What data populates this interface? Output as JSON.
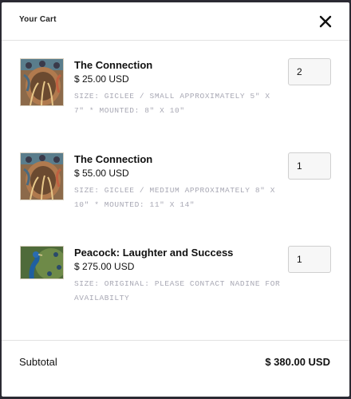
{
  "cart": {
    "title": "Your Cart",
    "close_icon": "close-icon"
  },
  "items": [
    {
      "name": "The Connection",
      "price": "$ 25.00 USD",
      "variant": "Size: Giclee / Small approximately 5\" x 7\" * Mounted: 8\" x 10\"",
      "quantity": "2",
      "image": "connection-artwork-thumbnail"
    },
    {
      "name": "The Connection",
      "price": "$ 55.00 USD",
      "variant": "Size: Giclee / Medium approximately 8\" x 10\" * Mounted: 11\" x 14\"",
      "quantity": "1",
      "image": "connection-artwork-thumbnail"
    },
    {
      "name": "Peacock: Laughter and Success",
      "price": "$ 275.00 USD",
      "variant": "Size: Original: Please contact Nadine for availabilty",
      "quantity": "1",
      "image": "peacock-artwork-thumbnail"
    }
  ],
  "footer": {
    "subtotal_label": "Subtotal",
    "subtotal_value": "$ 380.00 USD"
  }
}
